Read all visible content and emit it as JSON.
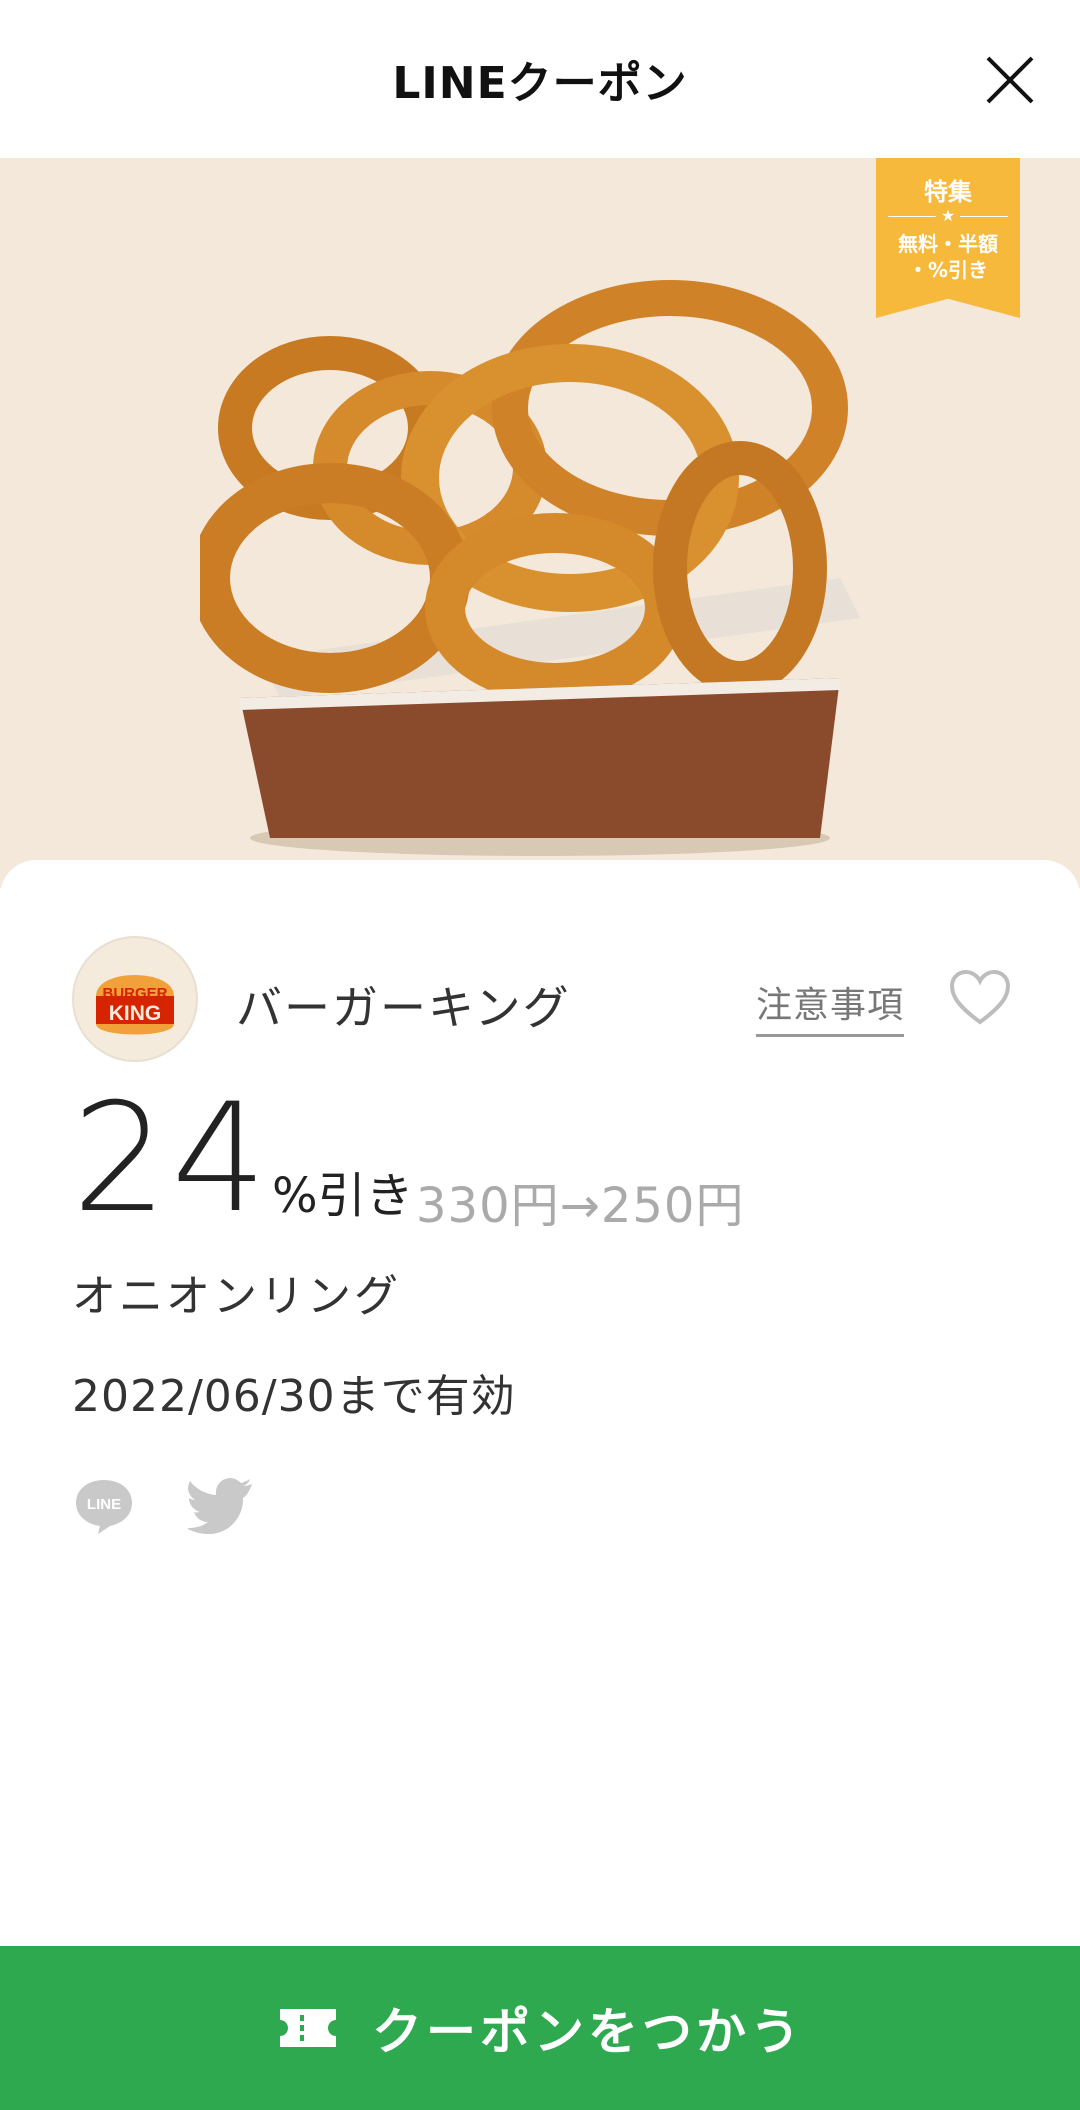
{
  "header": {
    "title": "LINEクーポン",
    "close_icon": "close-icon"
  },
  "hero": {
    "ribbon_line1": "特集",
    "ribbon_star": "★",
    "ribbon_line2": "無料・半額",
    "ribbon_line3": "・%引き",
    "background": "#f3e8da",
    "ribbon_color": "#f6b93b"
  },
  "brand": {
    "logo_line1": "BURGER",
    "logo_line2": "KING",
    "name": "バーガーキング",
    "notes_label": "注意事項",
    "favorite_icon": "heart-icon"
  },
  "coupon": {
    "discount_value": "24",
    "discount_unit": "%引き",
    "price_change": "330円→250円",
    "item_name": "オニオンリング",
    "valid_until": "2022/06/30まで有効"
  },
  "share": {
    "line_icon": "line-icon",
    "line_label": "LINE",
    "twitter_icon": "twitter-icon"
  },
  "cta": {
    "label": "クーポンをつかう",
    "icon": "ticket-icon",
    "color": "#2ea94f"
  }
}
